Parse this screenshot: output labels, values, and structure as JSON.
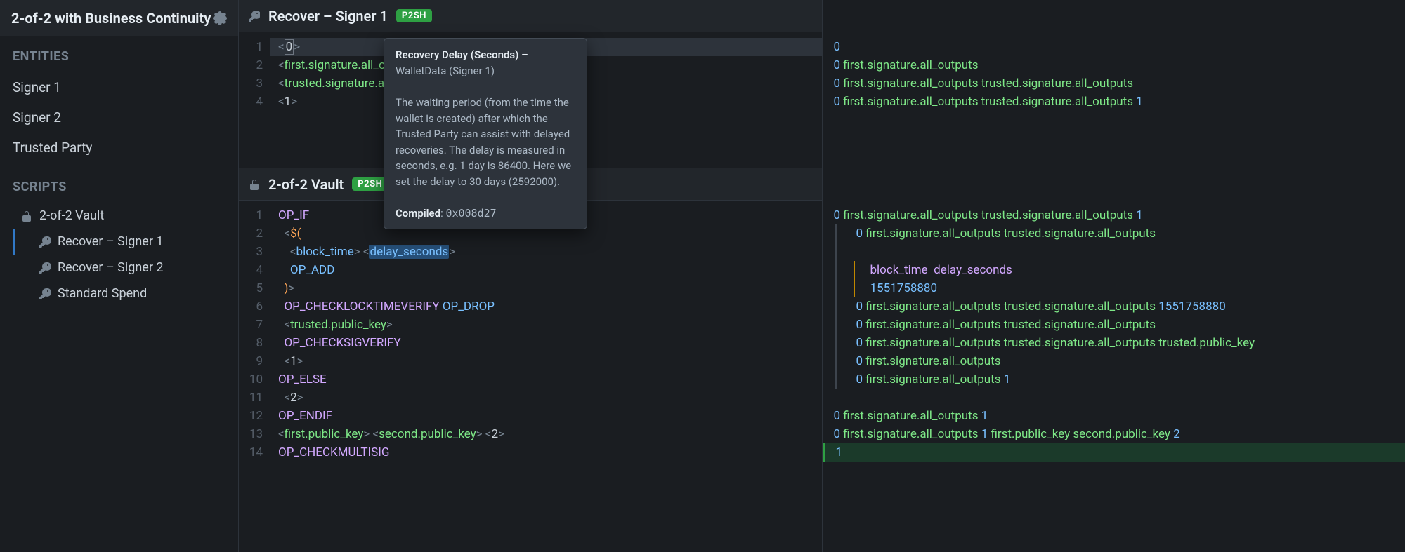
{
  "sidebar": {
    "title": "2-of-2 with Business Continuity",
    "entities_header": "ENTITIES",
    "entities": [
      {
        "label": "Signer 1"
      },
      {
        "label": "Signer 2"
      },
      {
        "label": "Trusted Party"
      }
    ],
    "scripts_header": "SCRIPTS",
    "scripts": {
      "root": {
        "label": "2-of-2 Vault"
      },
      "subs": [
        {
          "label": "Recover – Signer 1",
          "active": true
        },
        {
          "label": "Recover – Signer 2",
          "active": false
        },
        {
          "label": "Standard Spend",
          "active": false
        }
      ]
    }
  },
  "top_pane": {
    "title": "Recover – Signer 1",
    "badge": "P2SH",
    "lines": [
      {
        "n": "1",
        "html": "<span class='cursor-line'><span class='t-br'>&lt;</span><span class='caret-box'>0</span><span class='t-br'>&gt;</span></span>"
      },
      {
        "n": "2",
        "html": "<span class='t-br'>&lt;</span><span class='t-var'>first.signature.all_outputs</span><span class='t-br'>&gt;</span>"
      },
      {
        "n": "3",
        "html": "<span class='t-br'>&lt;</span><span class='t-var'>trusted.signature.all_outputs</span><span class='t-br'>&gt;</span>"
      },
      {
        "n": "4",
        "html": "<span class='t-br'>&lt;</span>1<span class='t-br'>&gt;</span>"
      }
    ],
    "stack": [
      {
        "cls": "",
        "html": "<span class='sk0'>0</span>"
      },
      {
        "cls": "",
        "html": "<span class='sk0'>0</span> <span class='sk1'>first.signature.all_outputs</span>"
      },
      {
        "cls": "",
        "html": "<span class='sk0'>0</span> <span class='sk1'>first.signature.all_outputs</span> <span class='sk1'>trusted.signature.all_outputs</span>"
      },
      {
        "cls": "",
        "html": "<span class='sk0'>0</span> <span class='sk1'>first.signature.all_outputs</span> <span class='sk1'>trusted.signature.all_outputs</span> <span class='sk0'>1</span>"
      }
    ]
  },
  "bottom_pane": {
    "title": "2-of-2 Vault",
    "badge": "P2SH",
    "lines": [
      {
        "n": "1",
        "html": "<span class='t-kw'>OP_IF</span>"
      },
      {
        "n": "2",
        "html": "  <span class='t-br'>&lt;</span><span class='t-macro'>$(</span>"
      },
      {
        "n": "3",
        "html": "    <span class='t-br'>&lt;</span><span class='t-op'>block_time</span><span class='t-br'>&gt;</span> <span class='t-br'>&lt;</span><span class='t-op t-hl'>delay_seconds</span><span class='t-br'>&gt;</span>"
      },
      {
        "n": "4",
        "html": "    <span class='t-op'>OP_ADD</span>"
      },
      {
        "n": "5",
        "html": "  <span class='t-macro'>)</span><span class='t-br'>&gt;</span>"
      },
      {
        "n": "6",
        "html": "  <span class='t-kw'>OP_CHECKLOCKTIMEVERIFY</span> <span class='t-op'>OP_DROP</span>"
      },
      {
        "n": "7",
        "html": "  <span class='t-br'>&lt;</span><span class='t-var'>trusted.public_key</span><span class='t-br'>&gt;</span>"
      },
      {
        "n": "8",
        "html": "  <span class='t-kw'>OP_CHECKSIGVERIFY</span>"
      },
      {
        "n": "9",
        "html": "  <span class='t-br'>&lt;</span>1<span class='t-br'>&gt;</span>"
      },
      {
        "n": "10",
        "html": "<span class='t-kw'>OP_ELSE</span>"
      },
      {
        "n": "11",
        "html": "  <span class='t-br'>&lt;</span>2<span class='t-br'>&gt;</span>"
      },
      {
        "n": "12",
        "html": "<span class='t-kw'>OP_ENDIF</span>"
      },
      {
        "n": "13",
        "html": "<span class='t-br'>&lt;</span><span class='t-var'>first.public_key</span><span class='t-br'>&gt;</span> <span class='t-br'>&lt;</span><span class='t-var'>second.public_key</span><span class='t-br'>&gt;</span> <span class='t-br'>&lt;</span>2<span class='t-br'>&gt;</span>"
      },
      {
        "n": "14",
        "html": "<span class='t-kw'>OP_CHECKMULTISIG</span>"
      }
    ],
    "stack": [
      {
        "cls": "",
        "html": "<span class='sk0'>0</span> <span class='sk1'>first.signature.all_outputs</span> <span class='sk1'>trusted.signature.all_outputs</span> <span class='sk0'>1</span>"
      },
      {
        "cls": "ind1",
        "html": "<span class='sk0'>0</span> <span class='sk1'>first.signature.all_outputs</span> <span class='sk1'>trusted.signature.all_outputs</span>"
      },
      {
        "cls": "ind1",
        "html": ""
      },
      {
        "cls": "ind2",
        "html": "<span class='sk2'>block_time</span>  <span class='sk2'>delay_seconds</span>"
      },
      {
        "cls": "ind2",
        "html": "<span class='sk0'>1551758880</span>"
      },
      {
        "cls": "ind1",
        "html": "<span class='sk0'>0</span> <span class='sk1'>first.signature.all_outputs</span> <span class='sk1'>trusted.signature.all_outputs</span> <span class='sk0'>1551758880</span>"
      },
      {
        "cls": "ind1",
        "html": "<span class='sk0'>0</span> <span class='sk1'>first.signature.all_outputs</span> <span class='sk1'>trusted.signature.all_outputs</span>"
      },
      {
        "cls": "ind1",
        "html": "<span class='sk0'>0</span> <span class='sk1'>first.signature.all_outputs</span> <span class='sk1'>trusted.signature.all_outputs</span> <span class='sk1'>trusted.public_key</span>"
      },
      {
        "cls": "ind1",
        "html": "<span class='sk0'>0</span> <span class='sk1'>first.signature.all_outputs</span>"
      },
      {
        "cls": "ind1",
        "html": "<span class='sk0'>0</span> <span class='sk1'>first.signature.all_outputs</span> <span class='sk0'>1</span>"
      },
      {
        "cls": "",
        "html": ""
      },
      {
        "cls": "",
        "html": "<span class='sk0'>0</span> <span class='sk1'>first.signature.all_outputs</span> <span class='sk0'>1</span>"
      },
      {
        "cls": "",
        "html": "<span class='sk0'>0</span> <span class='sk1'>first.signature.all_outputs</span> <span class='sk0'>1</span> <span class='sk1'>first.public_key</span> <span class='sk1'>second.public_key</span> <span class='sk0'>2</span>"
      },
      {
        "cls": "success",
        "html": "<span class='sk0'>1</span>"
      }
    ]
  },
  "tooltip": {
    "title": "Recovery Delay (Seconds) –",
    "sub": "WalletData (Signer 1)",
    "body": "The waiting period (from the time the wallet is created) after which the Trusted Party can assist with delayed recoveries. The delay is measured in seconds, e.g. 1 day is 86400. Here we set the delay to 30 days (2592000).",
    "compiled_label": "Compiled",
    "compiled_value": "0x008d27"
  }
}
